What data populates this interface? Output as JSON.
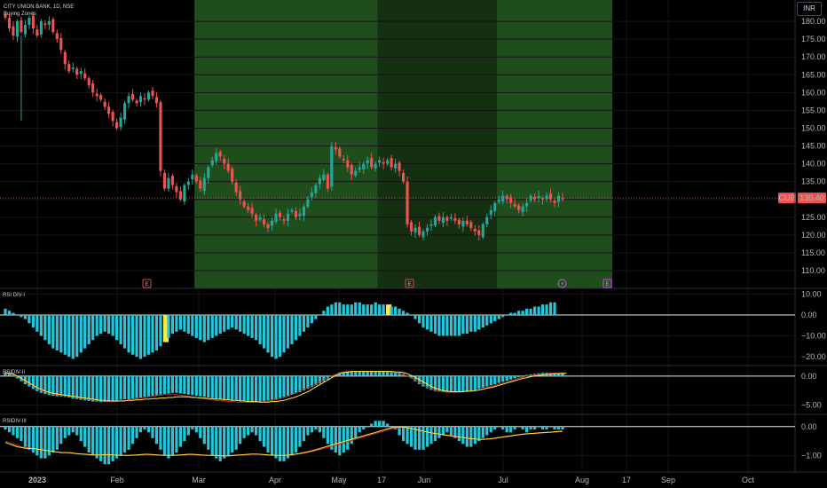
{
  "header": {
    "symbol_line": "CITY UNION BANK, 1D, NSE",
    "indicator_label": "Buying Zones"
  },
  "currency_button": "INR",
  "price_tag": {
    "ticker": "CUB",
    "price": "130.40"
  },
  "colors": {
    "up": "#26a69a",
    "down": "#ef5350",
    "zone_bright": "#1f4d1b",
    "zone_dark": "#142f12",
    "histogram": "#26c6da",
    "highlight": "#ffeb3b",
    "signal_yellow": "#ffeb3b",
    "signal_red": "#c62828"
  },
  "x_axis": {
    "labels": [
      "2023",
      "Feb",
      "Mar",
      "Apr",
      "May",
      "17",
      "Jun",
      "Jul",
      "Aug",
      "17",
      "Sep",
      "Oct"
    ]
  },
  "event_markers": [
    "E",
    "E",
    "⚡",
    "E"
  ],
  "chart_data": [
    {
      "type": "candlestick",
      "pane": "price",
      "ylim": [
        106,
        185
      ],
      "y_ticks": [
        "110.00",
        "115.00",
        "120.00",
        "125.00",
        "130.00",
        "135.00",
        "140.00",
        "145.00",
        "150.00",
        "155.00",
        "160.00",
        "165.00",
        "170.00",
        "175.00",
        "180.00"
      ],
      "y_tick_values": [
        110,
        115,
        120,
        125,
        130,
        135,
        140,
        145,
        150,
        155,
        160,
        165,
        170,
        175,
        180
      ],
      "last_price": 130.4,
      "zones": [
        {
          "start": 48,
          "end": 94,
          "shade": "bright"
        },
        {
          "start": 94,
          "end": 124,
          "shade": "dark"
        },
        {
          "start": 124,
          "end": 152,
          "shade": "bright"
        }
      ],
      "closes": [
        181,
        178,
        176,
        180,
        177,
        179,
        181,
        178,
        176,
        180,
        179,
        180,
        177,
        175,
        172,
        168,
        166,
        167,
        165,
        166,
        164,
        162,
        160,
        159,
        158,
        156,
        154,
        152,
        150,
        153,
        157,
        159,
        158,
        157,
        159,
        158,
        160,
        159,
        157,
        138,
        133,
        136,
        134,
        132,
        130,
        134,
        135,
        137,
        135,
        133,
        136,
        139,
        141,
        143,
        142,
        140,
        138,
        135,
        132,
        130,
        128,
        127,
        126,
        124,
        125,
        123,
        122,
        124,
        126,
        125,
        124,
        126,
        127,
        125,
        126,
        128,
        130,
        132,
        134,
        136,
        137,
        133,
        145,
        144,
        142,
        141,
        139,
        137,
        138,
        139,
        140,
        141,
        139,
        140,
        141,
        140,
        141,
        139,
        140,
        138,
        135,
        123,
        121,
        122,
        120,
        121,
        122,
        123,
        125,
        124,
        125,
        124,
        125,
        124,
        123,
        124,
        123,
        122,
        121,
        120,
        123,
        125,
        127,
        129,
        130,
        131,
        130,
        129,
        128,
        127,
        128,
        129,
        131,
        130,
        131,
        130,
        131,
        130,
        129,
        131,
        130
      ]
    },
    {
      "type": "bar",
      "pane": "RSI DIV-I",
      "name": "RSI DIV-I",
      "ylim": [
        -22.5,
        11
      ],
      "y_ticks": [
        "10.00",
        "0.00",
        "−10.00",
        "−20.00"
      ],
      "y_tick_values": [
        10,
        0,
        -10,
        -20
      ],
      "values": [
        3,
        2,
        1,
        0,
        -1,
        -2,
        -4,
        -6,
        -8,
        -10,
        -12,
        -14,
        -16,
        -17,
        -18,
        -19,
        -20,
        -21,
        -20,
        -18,
        -16,
        -14,
        -12,
        -10,
        -9,
        -8,
        -9,
        -10,
        -12,
        -14,
        -16,
        -18,
        -19,
        -20,
        -21,
        -20,
        -19,
        -18,
        -17,
        -15,
        -13,
        -11,
        -9,
        -8,
        -7,
        -8,
        -9,
        -10,
        -11,
        -12,
        -13,
        -12,
        -11,
        -10,
        -9,
        -8,
        -7,
        -6,
        -7,
        -8,
        -9,
        -10,
        -11,
        -12,
        -14,
        -16,
        -18,
        -20,
        -21,
        -20,
        -18,
        -16,
        -14,
        -12,
        -10,
        -8,
        -6,
        -4,
        -2,
        0,
        2,
        4,
        5,
        6,
        6,
        5,
        5,
        5,
        6,
        6,
        5,
        5,
        5,
        6,
        5,
        5,
        5,
        4,
        4,
        3,
        2,
        1,
        0,
        -2,
        -4,
        -6,
        -7,
        -8,
        -9,
        -10,
        -10,
        -10,
        -10,
        -10,
        -10,
        -9,
        -9,
        -8,
        -8,
        -7,
        -6,
        -5,
        -4,
        -3,
        -2,
        -1,
        0,
        1,
        1,
        2,
        2,
        3,
        3,
        4,
        4,
        5,
        5,
        6,
        6
      ],
      "highlights": [
        40,
        96
      ]
    },
    {
      "type": "bar_with_lines",
      "pane": "RSI DIV-II",
      "name": "RSIDIV-II",
      "ylim": [
        -6,
        1.2
      ],
      "y_ticks": [
        "0.00",
        "−5.00"
      ],
      "y_tick_values": [
        0,
        -5
      ],
      "values": [
        0.6,
        0.4,
        0.0,
        -0.4,
        -0.9,
        -1.4,
        -1.8,
        -2.2,
        -2.6,
        -2.9,
        -3.1,
        -3.3,
        -3.4,
        -3.5,
        -3.5,
        -3.6,
        -3.7,
        -3.9,
        -4.0,
        -4.1,
        -4.2,
        -4.3,
        -4.4,
        -4.4,
        -4.5,
        -4.5,
        -4.4,
        -4.3,
        -4.2,
        -4.1,
        -4.0,
        -4.0,
        -3.9,
        -3.8,
        -3.7,
        -3.6,
        -3.5,
        -3.4,
        -3.3,
        -3.2,
        -3.1,
        -3.0,
        -2.9,
        -2.9,
        -3.0,
        -3.1,
        -3.2,
        -3.3,
        -3.4,
        -3.5,
        -3.6,
        -3.7,
        -3.8,
        -3.9,
        -4.0,
        -4.0,
        -4.1,
        -4.2,
        -4.2,
        -4.3,
        -4.3,
        -4.3,
        -4.4,
        -4.4,
        -4.4,
        -4.3,
        -4.2,
        -4.1,
        -4.0,
        -3.8,
        -3.6,
        -3.4,
        -3.2,
        -3.0,
        -2.8,
        -2.5,
        -2.2,
        -1.9,
        -1.6,
        -1.3,
        -1.0,
        -0.6,
        -0.2,
        0.2,
        0.5,
        0.7,
        0.8,
        0.8,
        0.8,
        0.8,
        0.8,
        0.8,
        0.8,
        0.8,
        0.8,
        0.8,
        0.8,
        0.7,
        0.7,
        0.6,
        0.4,
        0.0,
        -0.4,
        -0.9,
        -1.4,
        -1.8,
        -2.1,
        -2.4,
        -2.6,
        -2.7,
        -2.8,
        -2.8,
        -2.8,
        -2.8,
        -2.8,
        -2.7,
        -2.6,
        -2.5,
        -2.4,
        -2.2,
        -2.0,
        -1.8,
        -1.6,
        -1.4,
        -1.2,
        -1.0,
        -0.8,
        -0.6,
        -0.4,
        -0.2,
        0.0,
        0.2,
        0.3,
        0.4,
        0.5,
        0.6,
        0.6,
        0.6,
        0.6,
        0.6,
        0.6
      ],
      "signal_yellow": [
        0.6,
        0.5,
        0.3,
        0.0,
        -0.4,
        -0.8,
        -1.2,
        -1.6,
        -2.0,
        -2.3,
        -2.6,
        -2.8,
        -3.0,
        -3.1,
        -3.2,
        -3.3,
        -3.4,
        -3.5,
        -3.6,
        -3.7,
        -3.8,
        -3.9,
        -4.0,
        -4.1,
        -4.2,
        -4.2,
        -4.3,
        -4.3,
        -4.3,
        -4.3,
        -4.3,
        -4.2,
        -4.2,
        -4.1,
        -4.1,
        -4.0,
        -4.0,
        -3.9,
        -3.9,
        -3.8,
        -3.8,
        -3.7,
        -3.7,
        -3.6,
        -3.6,
        -3.6,
        -3.6,
        -3.7,
        -3.7,
        -3.8,
        -3.8,
        -3.9,
        -3.9,
        -4.0,
        -4.0,
        -4.1,
        -4.1,
        -4.2,
        -4.2,
        -4.3,
        -4.3,
        -4.4,
        -4.4,
        -4.4,
        -4.5,
        -4.5,
        -4.5,
        -4.4,
        -4.4,
        -4.3,
        -4.2,
        -4.0,
        -3.8,
        -3.6,
        -3.3,
        -3.0,
        -2.7,
        -2.3,
        -1.9,
        -1.5,
        -1.1,
        -0.7,
        -0.3,
        0.1,
        0.4,
        0.6,
        0.7,
        0.8,
        0.8,
        0.8,
        0.8,
        0.8,
        0.8,
        0.8,
        0.8,
        0.8,
        0.8,
        0.8,
        0.7,
        0.7,
        0.6,
        0.4,
        0.1,
        -0.2,
        -0.6,
        -1.0,
        -1.4,
        -1.8,
        -2.1,
        -2.3,
        -2.5,
        -2.6,
        -2.7,
        -2.7,
        -2.7,
        -2.7,
        -2.6,
        -2.6,
        -2.5,
        -2.4,
        -2.3,
        -2.1,
        -2.0,
        -1.8,
        -1.6,
        -1.4,
        -1.2,
        -1.0,
        -0.8,
        -0.6,
        -0.4,
        -0.3,
        -0.1,
        0.0,
        0.1,
        0.2,
        0.3,
        0.3,
        0.4,
        0.4,
        0.4,
        0.5
      ],
      "signal_red": [
        0.5,
        0.4,
        0.2,
        -0.1,
        -0.5,
        -0.9,
        -1.3,
        -1.7,
        -2.1,
        -2.4,
        -2.7,
        -2.9,
        -3.1,
        -3.2,
        -3.3,
        -3.4,
        -3.5,
        -3.6,
        -3.7,
        -3.8,
        -3.9,
        -4.0,
        -4.1,
        -4.2,
        -4.3,
        -4.3,
        -4.4,
        -4.4,
        -4.4,
        -4.3,
        -4.2,
        -4.1,
        -4.0,
        -3.9,
        -3.8,
        -3.7,
        -3.6,
        -3.5,
        -3.4,
        -3.3,
        -3.2,
        -3.1,
        -3.1,
        -3.2,
        -3.3,
        -3.4,
        -3.5,
        -3.6,
        -3.7,
        -3.8,
        -3.9,
        -4.0,
        -4.1,
        -4.2,
        -4.3,
        -4.3,
        -4.4,
        -4.4,
        -4.5,
        -4.5,
        -4.5,
        -4.5,
        -4.5,
        -4.5,
        -4.5,
        -4.4,
        -4.3,
        -4.2,
        -4.1,
        -3.9,
        -3.7,
        -3.5,
        -3.2,
        -2.9,
        -2.6,
        -2.3,
        -2.0,
        -1.7,
        -1.4,
        -1.0,
        -0.7,
        -0.3,
        0.0,
        0.3,
        0.6,
        0.7,
        0.8,
        0.8,
        0.8,
        0.8,
        0.8,
        0.8,
        0.8,
        0.8,
        0.8,
        0.8,
        0.8,
        0.7,
        0.6,
        0.4,
        0.2,
        0.0,
        -0.3,
        -0.7,
        -1.1,
        -1.5,
        -1.9,
        -2.2,
        -2.5,
        -2.6,
        -2.7,
        -2.8,
        -2.8,
        -2.8,
        -2.8,
        -2.7,
        -2.7,
        -2.6,
        -2.5,
        -2.4,
        -2.2,
        -2.0,
        -1.8,
        -1.6,
        -1.4,
        -1.2,
        -1.0,
        -0.8,
        -0.6,
        -0.4,
        -0.2,
        0.0,
        0.1,
        0.2,
        0.3,
        0.4,
        0.4,
        0.5,
        0.5,
        0.5,
        0.6
      ]
    },
    {
      "type": "bar_with_lines",
      "pane": "RSI DIV-III",
      "name": "RSIDIV-III",
      "ylim": [
        -1.45,
        0.3
      ],
      "y_ticks": [
        "0.00",
        "−1.00"
      ],
      "y_tick_values": [
        0,
        -1
      ],
      "values": [
        -0.1,
        -0.2,
        -0.3,
        -0.4,
        -0.5,
        -0.7,
        -0.8,
        -0.9,
        -1.0,
        -1.1,
        -1.1,
        -1.0,
        -0.9,
        -0.8,
        -0.6,
        -0.4,
        -0.3,
        -0.2,
        -0.3,
        -0.5,
        -0.7,
        -0.9,
        -1.0,
        -1.1,
        -1.2,
        -1.3,
        -1.3,
        -1.2,
        -1.1,
        -1.0,
        -0.9,
        -0.8,
        -0.6,
        -0.4,
        -0.2,
        -0.1,
        -0.2,
        -0.4,
        -0.6,
        -0.8,
        -1.0,
        -1.1,
        -1.0,
        -0.9,
        -0.7,
        -0.5,
        -0.3,
        -0.1,
        -0.2,
        -0.4,
        -0.6,
        -0.8,
        -1.0,
        -1.1,
        -1.2,
        -1.1,
        -1.0,
        -0.9,
        -0.8,
        -0.6,
        -0.4,
        -0.3,
        -0.2,
        -0.3,
        -0.5,
        -0.7,
        -0.9,
        -1.0,
        -1.1,
        -1.2,
        -1.2,
        -1.1,
        -1.0,
        -0.9,
        -0.7,
        -0.5,
        -0.3,
        -0.2,
        -0.1,
        -0.2,
        -0.4,
        -0.6,
        -0.8,
        -0.9,
        -1.0,
        -0.9,
        -0.8,
        -0.6,
        -0.4,
        -0.2,
        -0.1,
        0.0,
        0.1,
        0.2,
        0.2,
        0.2,
        0.1,
        0.0,
        -0.1,
        -0.3,
        -0.5,
        -0.6,
        -0.7,
        -0.8,
        -0.8,
        -0.8,
        -0.7,
        -0.6,
        -0.5,
        -0.4,
        -0.3,
        -0.2,
        -0.3,
        -0.4,
        -0.5,
        -0.6,
        -0.7,
        -0.7,
        -0.6,
        -0.5,
        -0.4,
        -0.3,
        -0.2,
        -0.1,
        0.0,
        -0.1,
        -0.2,
        -0.2,
        -0.1,
        0.0,
        -0.1,
        -0.2,
        -0.1,
        -0.1,
        0.0,
        -0.1,
        -0.1,
        0.0,
        -0.1,
        -0.1,
        -0.1
      ],
      "signal_yellow": [
        -0.55,
        -0.6,
        -0.65,
        -0.7,
        -0.72,
        -0.75,
        -0.75,
        -0.76,
        -0.78,
        -0.8,
        -0.82,
        -0.84,
        -0.86,
        -0.88,
        -0.9,
        -0.9,
        -0.9,
        -0.92,
        -0.94,
        -0.95,
        -0.96,
        -0.97,
        -0.98,
        -0.98,
        -0.98,
        -0.97,
        -0.97,
        -0.98,
        -0.99,
        -1.0,
        -1.0,
        -1.0,
        -0.99,
        -0.98,
        -0.97,
        -0.96,
        -0.96,
        -0.97,
        -0.98,
        -0.99,
        -1.0,
        -1.0,
        -1.0,
        -0.99,
        -0.98,
        -0.97,
        -0.96,
        -0.96,
        -0.97,
        -0.98,
        -0.99,
        -1.0,
        -1.0,
        -1.0,
        -1.01,
        -1.01,
        -1.01,
        -1.0,
        -0.99,
        -0.98,
        -0.97,
        -0.96,
        -0.95,
        -0.95,
        -0.96,
        -0.97,
        -0.98,
        -0.99,
        -1.0,
        -1.0,
        -1.0,
        -0.99,
        -0.97,
        -0.95,
        -0.93,
        -0.9,
        -0.87,
        -0.84,
        -0.8,
        -0.76,
        -0.72,
        -0.68,
        -0.64,
        -0.6,
        -0.56,
        -0.52,
        -0.48,
        -0.44,
        -0.4,
        -0.36,
        -0.32,
        -0.28,
        -0.24,
        -0.2,
        -0.16,
        -0.12,
        -0.08,
        -0.04,
        -0.02,
        -0.01,
        -0.02,
        -0.04,
        -0.07,
        -0.1,
        -0.13,
        -0.16,
        -0.19,
        -0.22,
        -0.24,
        -0.26,
        -0.28,
        -0.3,
        -0.32,
        -0.34,
        -0.36,
        -0.38,
        -0.4,
        -0.42,
        -0.43,
        -0.44,
        -0.44,
        -0.43,
        -0.42,
        -0.4,
        -0.38,
        -0.36,
        -0.34,
        -0.32,
        -0.3,
        -0.28,
        -0.26,
        -0.25,
        -0.24,
        -0.23,
        -0.22,
        -0.21,
        -0.2,
        -0.19,
        -0.18,
        -0.17,
        -0.16
      ],
      "signal_red": [
        -0.5,
        -0.55,
        -0.6,
        -0.65,
        -0.7,
        -0.72,
        -0.74,
        -0.76,
        -0.78,
        -0.8,
        -0.82,
        -0.84,
        -0.86,
        -0.88,
        -0.89,
        -0.9,
        -0.91,
        -0.92,
        -0.93,
        -0.94,
        -0.95,
        -0.96,
        -0.97,
        -0.97,
        -0.97,
        -0.97,
        -0.97,
        -0.98,
        -0.99,
        -1.0,
        -1.0,
        -1.0,
        -1.0,
        -0.99,
        -0.98,
        -0.97,
        -0.97,
        -0.97,
        -0.98,
        -0.99,
        -1.0,
        -1.0,
        -1.0,
        -1.0,
        -0.99,
        -0.98,
        -0.97,
        -0.97,
        -0.97,
        -0.98,
        -0.99,
        -1.0,
        -1.0,
        -1.01,
        -1.01,
        -1.02,
        -1.02,
        -1.01,
        -1.0,
        -0.99,
        -0.98,
        -0.97,
        -0.96,
        -0.96,
        -0.96,
        -0.97,
        -0.98,
        -0.99,
        -1.0,
        -1.0,
        -1.0,
        -0.99,
        -0.98,
        -0.96,
        -0.94,
        -0.92,
        -0.89,
        -0.86,
        -0.83,
        -0.8,
        -0.76,
        -0.72,
        -0.68,
        -0.64,
        -0.6,
        -0.56,
        -0.52,
        -0.48,
        -0.44,
        -0.4,
        -0.36,
        -0.32,
        -0.28,
        -0.24,
        -0.2,
        -0.16,
        -0.12,
        -0.08,
        -0.05,
        -0.03,
        -0.03,
        -0.05,
        -0.08,
        -0.11,
        -0.14,
        -0.17,
        -0.2,
        -0.23,
        -0.25,
        -0.27,
        -0.29,
        -0.31,
        -0.33,
        -0.35,
        -0.37,
        -0.39,
        -0.41,
        -0.43,
        -0.44,
        -0.45,
        -0.45,
        -0.44,
        -0.43,
        -0.41,
        -0.39,
        -0.37,
        -0.35,
        -0.33,
        -0.31,
        -0.29,
        -0.27,
        -0.26,
        -0.25,
        -0.24,
        -0.23,
        -0.22,
        -0.21,
        -0.2,
        -0.19,
        -0.18,
        -0.17
      ]
    }
  ]
}
